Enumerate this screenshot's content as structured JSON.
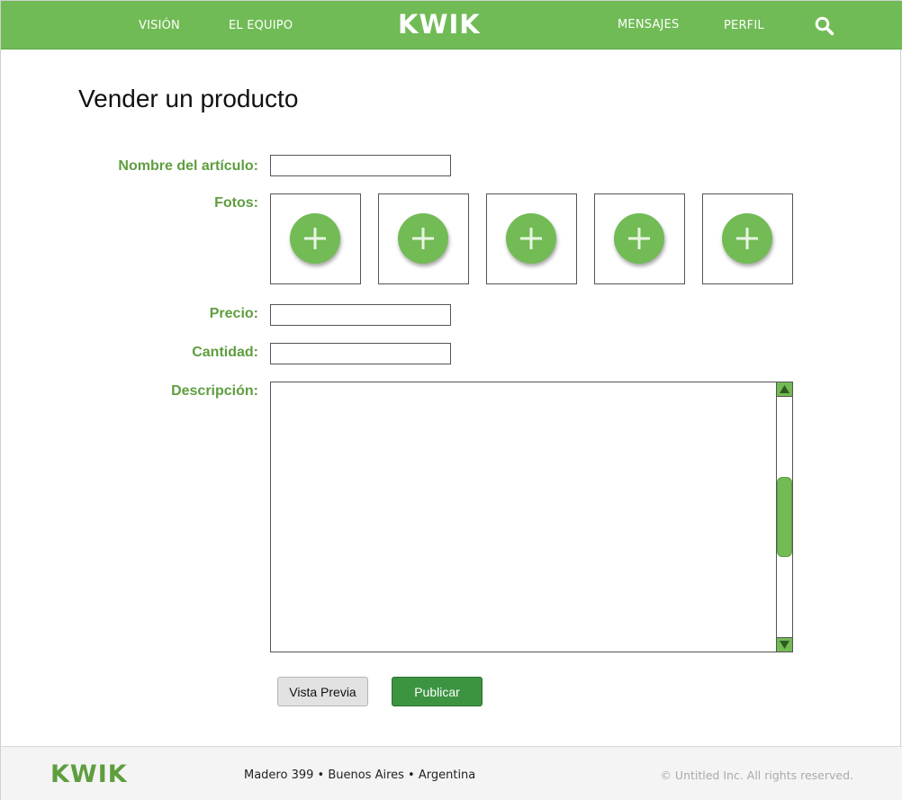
{
  "colors": {
    "brand_green": "#70bb55",
    "label_green": "#5e9e3f",
    "publish_green": "#3c9441",
    "preview_gray": "#e2e2e2",
    "footer_bg": "#f4f4f4"
  },
  "navbar": {
    "links": [
      "VISIÓN",
      "EL EQUIPO",
      "MENSAJES",
      "PERFIL"
    ],
    "logo": "KWIK",
    "search_icon": "search-icon"
  },
  "page": {
    "title": "Vender un producto"
  },
  "form": {
    "name_label": "Nombre del artículo:",
    "name_value": "",
    "photos_label": "Fotos:",
    "photo_slots": 5,
    "photo_icon": "plus-circle-icon",
    "price_label": "Precio:",
    "price_value": "",
    "quantity_label": "Cantidad:",
    "quantity_value": "",
    "description_label": "Descripción:",
    "description_value": ""
  },
  "buttons": {
    "preview": "Vista Previa",
    "publish": "Publicar"
  },
  "footer": {
    "logo": "KWIK",
    "address": "Madero 399 • Buenos Aires • Argentina",
    "copyright": "© Untitled Inc. All rights reserved."
  }
}
